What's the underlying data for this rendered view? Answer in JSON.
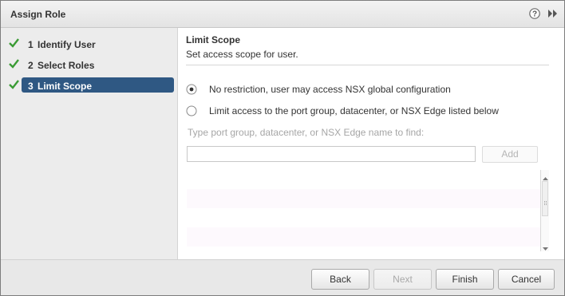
{
  "dialog": {
    "title": "Assign Role",
    "icons": [
      "help-icon",
      "expand-icon"
    ]
  },
  "steps": [
    {
      "number": "1",
      "label": "Identify User",
      "completed": true,
      "active": false
    },
    {
      "number": "2",
      "label": "Select Roles",
      "completed": true,
      "active": false
    },
    {
      "number": "3",
      "label": "Limit Scope",
      "completed": true,
      "active": true
    }
  ],
  "main": {
    "heading": "Limit Scope",
    "subheading": "Set access scope for user.",
    "options": [
      {
        "label": "No restriction, user may access NSX global configuration",
        "selected": true
      },
      {
        "label": "Limit access to the port group, datacenter, or NSX Edge listed below",
        "selected": false
      }
    ],
    "find_label": "Type port group, datacenter, or NSX Edge name to find:",
    "find_value": "",
    "add_label": "Add"
  },
  "footer": {
    "back": "Back",
    "next": "Next",
    "finish": "Finish",
    "cancel": "Cancel"
  },
  "colors": {
    "active_step": "#2f5883",
    "check": "#3a9b34"
  }
}
